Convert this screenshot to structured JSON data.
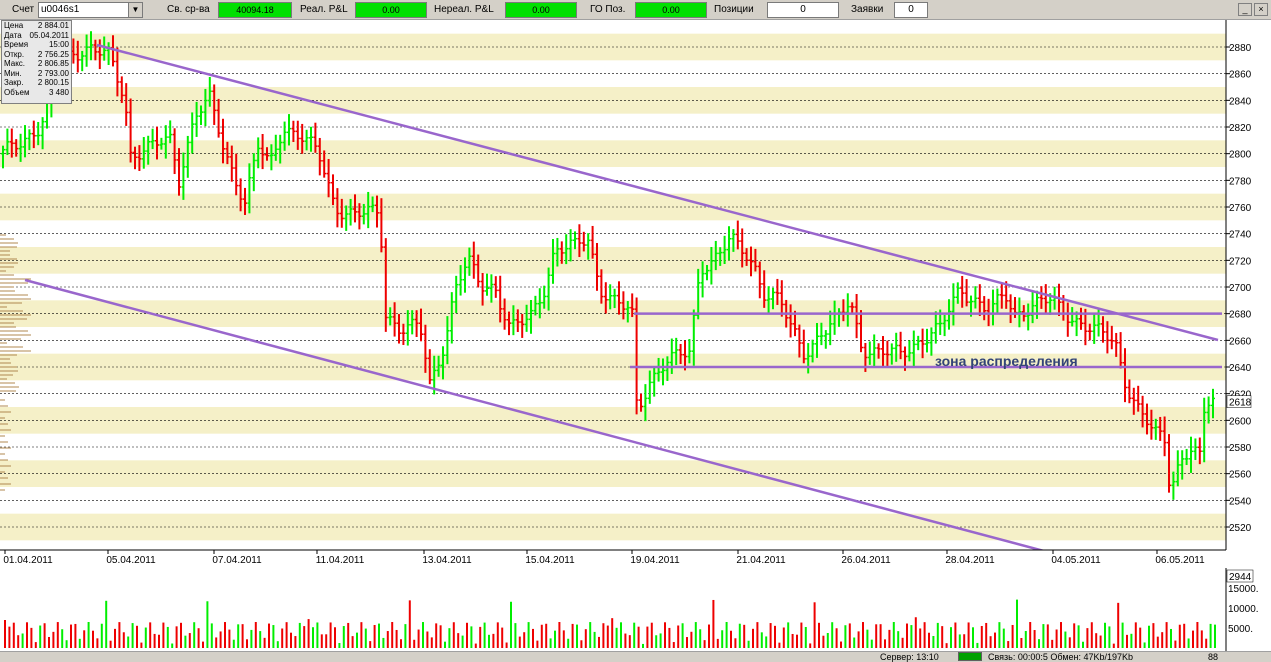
{
  "toolbar": {
    "account_label": "Счет",
    "account_value": "u0046s1",
    "free_funds_label": "Св. ср-ва",
    "free_funds_value": "40094.18",
    "real_pl_label": "Реал. P&L",
    "real_pl_value": "0.00",
    "unreal_pl_label": "Нереал. P&L",
    "unreal_pl_value": "0.00",
    "go_label": "ГО Поз.",
    "go_value": "0.00",
    "positions_label": "Позиции",
    "positions_value": "0",
    "orders_label": "Заявки",
    "orders_value": "0"
  },
  "infobox": [
    {
      "k": "Цена",
      "v": "2 884.01"
    },
    {
      "k": "Дата",
      "v": "05.04.2011"
    },
    {
      "k": "Время",
      "v": "15:00"
    },
    {
      "k": "Откр.",
      "v": "2 756.25"
    },
    {
      "k": "Макс.",
      "v": "2 806.85"
    },
    {
      "k": "Мин.",
      "v": "2 793.00"
    },
    {
      "k": "Закр.",
      "v": "2 800.15"
    },
    {
      "k": "Объем",
      "v": "3 480"
    }
  ],
  "annotation_text": "зона распределения",
  "status": {
    "server": "Сервер: 13:10",
    "connection": "Связь: 00:00:5 Обмен: 47Kb/197Kb",
    "code": "88"
  },
  "colors": {
    "up": "#00ee00",
    "down": "#ee0000",
    "trend": "#9966cc",
    "band": "#f5f0c8",
    "label": "#334477"
  },
  "chart_data": {
    "type": "candlestick",
    "y_ticks": [
      2520,
      2540,
      2560,
      2580,
      2600,
      2620,
      2640,
      2660,
      2680,
      2700,
      2720,
      2740,
      2760,
      2780,
      2800,
      2820,
      2840,
      2860,
      2880
    ],
    "last_price_label": "2618",
    "ylim": [
      2505,
      2895
    ],
    "x_labels": [
      "01.04.2011",
      "05.04.2011",
      "07.04.2011",
      "11.04.2011",
      "13.04.2011",
      "15.04.2011",
      "19.04.2011",
      "21.04.2011",
      "26.04.2011",
      "28.04.2011",
      "04.05.2011",
      "06.05.2011"
    ],
    "horizontal_levels": [
      2680,
      2640
    ],
    "trend_lines": [
      {
        "from": [
          "05.04.2011",
          2884
        ],
        "to": [
          "06.05.2011",
          2663
        ]
      },
      {
        "from": [
          "01.04.2011",
          2710
        ],
        "to": [
          "06.05.2011",
          2518
        ]
      }
    ],
    "volume_ticks": [
      "15000.",
      "10000.",
      "5000."
    ],
    "volume_last": "2944",
    "volume_ylim": [
      0,
      20000
    ]
  }
}
